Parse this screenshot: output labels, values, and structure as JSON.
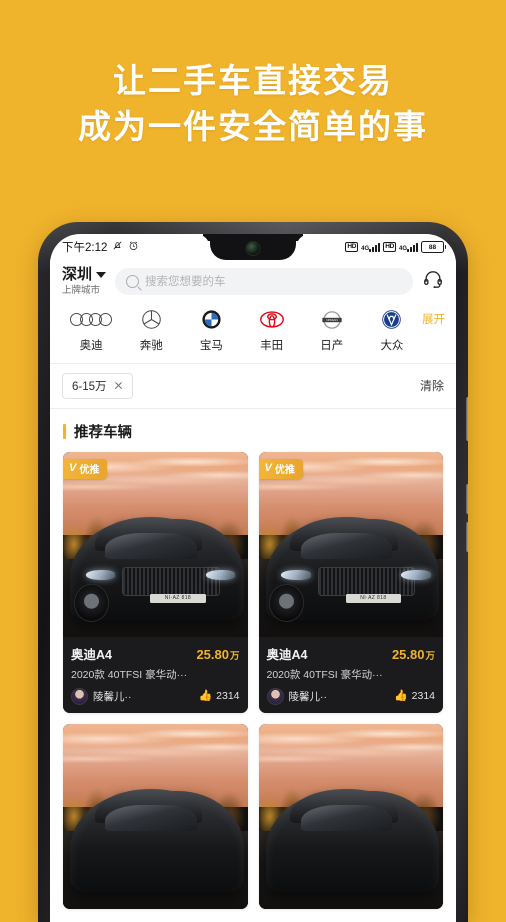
{
  "hero": {
    "line1": "让二手车直接交易",
    "line2": "成为一件安全简单的事",
    "color": "#FFFFFF",
    "background": "#F0B32C"
  },
  "statusbar": {
    "time": "下午2:12",
    "mute_icon": "bell-muted-icon",
    "alarm_icon": "alarm-clock-icon",
    "hd1": "HD",
    "net1": "4G",
    "hd2": "HD",
    "net2": "4G",
    "battery": "88"
  },
  "topbar": {
    "city": "深圳",
    "city_sub": "上牌城市",
    "caret_icon": "chevron-down-icon",
    "search_placeholder": "搜索您想要的车",
    "search_value": "",
    "search_icon": "search-icon",
    "service_icon": "headset-icon"
  },
  "brands": {
    "expand_label": "展开",
    "expand_color": "#F0B32C",
    "items": [
      {
        "name": "奥迪",
        "logo": "audi-rings-logo"
      },
      {
        "name": "奔驰",
        "logo": "mercedes-star-logo"
      },
      {
        "name": "宝马",
        "logo": "bmw-roundel-logo"
      },
      {
        "name": "丰田",
        "logo": "toyota-ovals-logo"
      },
      {
        "name": "日产",
        "logo": "nissan-logo"
      },
      {
        "name": "大众",
        "logo": "volkswagen-logo"
      }
    ]
  },
  "filters": {
    "chips": [
      {
        "label": "6-15万",
        "close_icon": "close-icon"
      }
    ],
    "clear_label": "清除"
  },
  "section": {
    "title": "推荐车辆",
    "accent": "#F0B32C"
  },
  "cards": [
    {
      "badge": "优推",
      "badge_mark": "V",
      "title": "奥迪A4",
      "price": "25.80",
      "price_unit": "万",
      "spec": "2020款 40TFSI 豪华动···",
      "seller": "陵馨儿··",
      "likes": "2314",
      "like_icon": "thumbs-up-icon",
      "plate": "NI·AZ 818"
    },
    {
      "badge": "优推",
      "badge_mark": "V",
      "title": "奥迪A4",
      "price": "25.80",
      "price_unit": "万",
      "spec": "2020款 40TFSI 豪华动···",
      "seller": "陵馨儿··",
      "likes": "2314",
      "like_icon": "thumbs-up-icon",
      "plate": "NI·AZ 818"
    },
    {
      "partial": true
    },
    {
      "partial": true
    }
  ]
}
